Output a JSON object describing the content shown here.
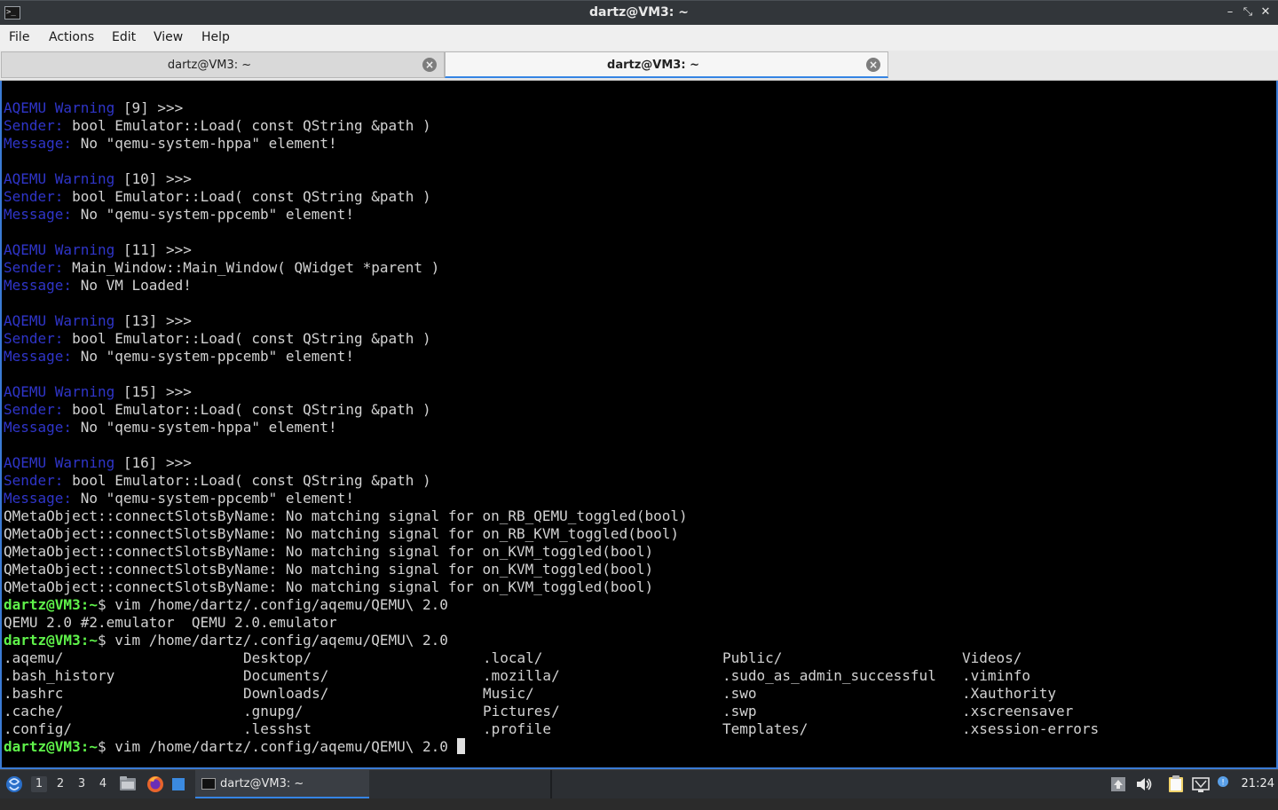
{
  "window": {
    "title": "dartz@VM3: ~",
    "app_icon": "terminal-icon",
    "controls": [
      "minimize-icon",
      "maximize-icon",
      "close-icon"
    ]
  },
  "menu": [
    "File",
    "Actions",
    "Edit",
    "View",
    "Help"
  ],
  "tabs": [
    {
      "label": "dartz@VM3: ~",
      "active": false
    },
    {
      "label": "dartz@VM3: ~",
      "active": true
    }
  ],
  "terminal": {
    "lines": [
      {
        "segments": [
          {
            "text": "AQEMU Warning",
            "color": "blue"
          },
          {
            "text": " [9] >>>",
            "color": "white"
          }
        ]
      },
      {
        "segments": [
          {
            "text": "Sender:",
            "color": "blue"
          },
          {
            "text": " bool Emulator::Load( const QString &path )",
            "color": "white"
          }
        ]
      },
      {
        "segments": [
          {
            "text": "Message:",
            "color": "blue"
          },
          {
            "text": " No \"qemu-system-hppa\" element!",
            "color": "white"
          }
        ]
      },
      {
        "segments": []
      },
      {
        "segments": [
          {
            "text": "AQEMU Warning",
            "color": "blue"
          },
          {
            "text": " [10] >>>",
            "color": "white"
          }
        ]
      },
      {
        "segments": [
          {
            "text": "Sender:",
            "color": "blue"
          },
          {
            "text": " bool Emulator::Load( const QString &path )",
            "color": "white"
          }
        ]
      },
      {
        "segments": [
          {
            "text": "Message:",
            "color": "blue"
          },
          {
            "text": " No \"qemu-system-ppcemb\" element!",
            "color": "white"
          }
        ]
      },
      {
        "segments": []
      },
      {
        "segments": [
          {
            "text": "AQEMU Warning",
            "color": "blue"
          },
          {
            "text": " [11] >>>",
            "color": "white"
          }
        ]
      },
      {
        "segments": [
          {
            "text": "Sender:",
            "color": "blue"
          },
          {
            "text": " Main_Window::Main_Window( QWidget *parent )",
            "color": "white"
          }
        ]
      },
      {
        "segments": [
          {
            "text": "Message:",
            "color": "blue"
          },
          {
            "text": " No VM Loaded!",
            "color": "white"
          }
        ]
      },
      {
        "segments": []
      },
      {
        "segments": [
          {
            "text": "AQEMU Warning",
            "color": "blue"
          },
          {
            "text": " [13] >>>",
            "color": "white"
          }
        ]
      },
      {
        "segments": [
          {
            "text": "Sender:",
            "color": "blue"
          },
          {
            "text": " bool Emulator::Load( const QString &path )",
            "color": "white"
          }
        ]
      },
      {
        "segments": [
          {
            "text": "Message:",
            "color": "blue"
          },
          {
            "text": " No \"qemu-system-ppcemb\" element!",
            "color": "white"
          }
        ]
      },
      {
        "segments": []
      },
      {
        "segments": [
          {
            "text": "AQEMU Warning",
            "color": "blue"
          },
          {
            "text": " [15] >>>",
            "color": "white"
          }
        ]
      },
      {
        "segments": [
          {
            "text": "Sender:",
            "color": "blue"
          },
          {
            "text": " bool Emulator::Load( const QString &path )",
            "color": "white"
          }
        ]
      },
      {
        "segments": [
          {
            "text": "Message:",
            "color": "blue"
          },
          {
            "text": " No \"qemu-system-hppa\" element!",
            "color": "white"
          }
        ]
      },
      {
        "segments": []
      },
      {
        "segments": [
          {
            "text": "AQEMU Warning",
            "color": "blue"
          },
          {
            "text": " [16] >>>",
            "color": "white"
          }
        ]
      },
      {
        "segments": [
          {
            "text": "Sender:",
            "color": "blue"
          },
          {
            "text": " bool Emulator::Load( const QString &path )",
            "color": "white"
          }
        ]
      },
      {
        "segments": [
          {
            "text": "Message:",
            "color": "blue"
          },
          {
            "text": " No \"qemu-system-ppcemb\" element!",
            "color": "white"
          }
        ]
      },
      {
        "segments": [
          {
            "text": "QMetaObject::connectSlotsByName: No matching signal for on_RB_QEMU_toggled(bool)",
            "color": "white"
          }
        ]
      },
      {
        "segments": [
          {
            "text": "QMetaObject::connectSlotsByName: No matching signal for on_RB_KVM_toggled(bool)",
            "color": "white"
          }
        ]
      },
      {
        "segments": [
          {
            "text": "QMetaObject::connectSlotsByName: No matching signal for on_KVM_toggled(bool)",
            "color": "white"
          }
        ]
      },
      {
        "segments": [
          {
            "text": "QMetaObject::connectSlotsByName: No matching signal for on_KVM_toggled(bool)",
            "color": "white"
          }
        ]
      },
      {
        "segments": [
          {
            "text": "QMetaObject::connectSlotsByName: No matching signal for on_KVM_toggled(bool)",
            "color": "white"
          }
        ]
      },
      {
        "segments": [
          {
            "text": "dartz@VM3:~",
            "color": "green"
          },
          {
            "text": "$ vim /home/dartz/.config/aqemu/QEMU\\ 2.0",
            "color": "white"
          }
        ]
      },
      {
        "segments": [
          {
            "text": "QEMU 2.0 #2.emulator  QEMU 2.0.emulator",
            "color": "white"
          }
        ]
      },
      {
        "segments": [
          {
            "text": "dartz@VM3:~",
            "color": "green"
          },
          {
            "text": "$ vim /home/dartz/.config/aqemu/QEMU\\ 2.0",
            "color": "white"
          }
        ]
      }
    ],
    "completion_columns": [
      [
        ".aqemu/",
        ".bash_history",
        ".bashrc",
        ".cache/",
        ".config/"
      ],
      [
        "Desktop/",
        "Documents/",
        "Downloads/",
        ".gnupg/",
        ".lesshst"
      ],
      [
        ".local/",
        ".mozilla/",
        "Music/",
        "Pictures/",
        ".profile"
      ],
      [
        "Public/",
        ".sudo_as_admin_successful",
        ".swo",
        ".swp",
        "Templates/"
      ],
      [
        "Videos/",
        ".viminfo",
        ".Xauthority",
        ".xscreensaver",
        ".xsession-errors"
      ]
    ],
    "last_prompt": {
      "prompt": "dartz@VM3:~",
      "command": "$ vim /home/dartz/.config/aqemu/QEMU\\ 2.0 "
    },
    "colors": {
      "blue": "#2f35c9",
      "green": "#5ff24a",
      "white": "#d2d2d2",
      "background": "#000000"
    }
  },
  "taskbar": {
    "start_icon": "lxqt-menu-icon",
    "workspaces": [
      "1",
      "2",
      "3",
      "4"
    ],
    "active_workspace": "1",
    "launchers": [
      "file-manager-icon",
      "firefox-icon",
      "desktop-icon"
    ],
    "task_label": "dartz@VM3: ~",
    "tray_icons": [
      "upload-icon",
      "volume-icon",
      "clipboard-icon",
      "network-icon",
      "notification-icon"
    ],
    "clock": "21:24"
  }
}
